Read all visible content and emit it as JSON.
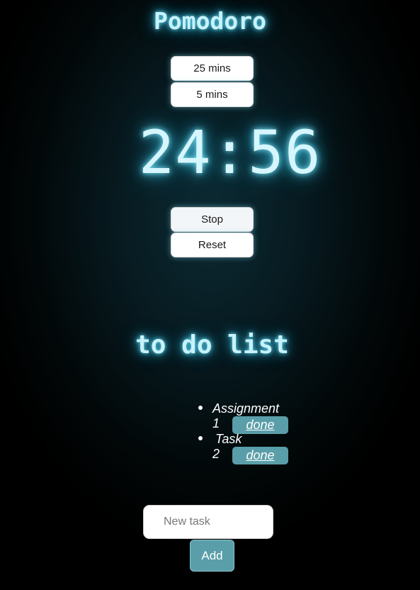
{
  "app": {
    "title": "Pomodoro"
  },
  "modes": {
    "work_label": "25 mins",
    "break_label": "5 mins"
  },
  "timer": {
    "display": "24:56"
  },
  "controls": {
    "stop_label": "Stop",
    "reset_label": "Reset"
  },
  "todo": {
    "title": "to do list",
    "tasks": [
      {
        "line1": "Assignment",
        "line2": "1",
        "done_label": "done"
      },
      {
        "line1": "Task",
        "line2": "2",
        "done_label": "done"
      }
    ],
    "new_task_placeholder": "New task",
    "add_label": "Add"
  },
  "colors": {
    "glow": "#63d7f0",
    "accent_button": "#5a9ea9",
    "background": "#000000"
  }
}
